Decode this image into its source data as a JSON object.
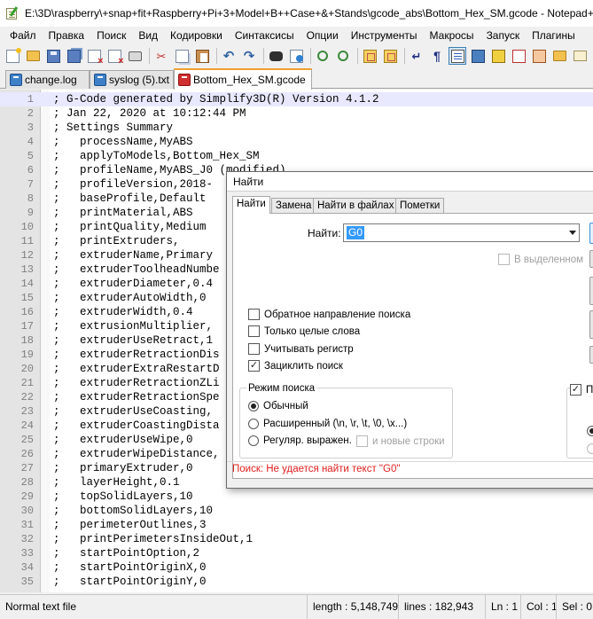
{
  "window": {
    "title": "E:\\3D\\raspberry\\+snap+fit+Raspberry+Pi+3+Model+B++Case+&+Stands\\gcode_abs\\Bottom_Hex_SM.gcode - Notepad++"
  },
  "menu": [
    "Файл",
    "Правка",
    "Поиск",
    "Вид",
    "Кодировки",
    "Синтаксисы",
    "Опции",
    "Инструменты",
    "Макросы",
    "Запуск",
    "Плагины"
  ],
  "toolbar": {
    "icons": [
      "new-file-icon",
      "open-folder-icon",
      "save-icon",
      "save-all-icon",
      "close-icon",
      "close-all-icon",
      "print-icon",
      "cut-icon",
      "copy-icon",
      "paste-icon",
      "undo-icon",
      "redo-icon",
      "find-icon",
      "replace-icon",
      "zoom-in-icon",
      "zoom-out-icon",
      "sync-scroll-v-icon",
      "sync-scroll-h-icon",
      "word-wrap-icon",
      "show-all-chars-icon",
      "indent-guide-icon",
      "user-language-icon",
      "fold-icon",
      "document-map-icon",
      "function-list-icon",
      "folder-workspace-icon",
      "monitoring-icon",
      "record-macro-icon"
    ]
  },
  "tabs": [
    {
      "label": "change.log",
      "active": false,
      "icon_color": "#3d80c8"
    },
    {
      "label": "syslog (5).txt",
      "active": false,
      "icon_color": "#3d80c8"
    },
    {
      "label": "Bottom_Hex_SM.gcode",
      "active": true,
      "icon_color": "#d03030"
    }
  ],
  "editor": {
    "lines": [
      {
        "n": "1",
        "text": "; G-Code generated by Simplify3D(R) Version 4.1.2"
      },
      {
        "n": "2",
        "text": "; Jan 22, 2020 at 10:12:44 PM"
      },
      {
        "n": "3",
        "text": "; Settings Summary"
      },
      {
        "n": "4",
        "text": ";   processName,MyABS"
      },
      {
        "n": "5",
        "text": ";   applyToModels,Bottom_Hex_SM"
      },
      {
        "n": "6",
        "text": ";   profileName,MyABS_J0 (modified)"
      },
      {
        "n": "7",
        "text": ";   profileVersion,2018-"
      },
      {
        "n": "8",
        "text": ";   baseProfile,Default"
      },
      {
        "n": "9",
        "text": ";   printMaterial,ABS"
      },
      {
        "n": "10",
        "text": ";   printQuality,Medium"
      },
      {
        "n": "11",
        "text": ";   printExtruders,"
      },
      {
        "n": "12",
        "text": ";   extruderName,Primary"
      },
      {
        "n": "13",
        "text": ";   extruderToolheadNumbe"
      },
      {
        "n": "14",
        "text": ";   extruderDiameter,0.4"
      },
      {
        "n": "15",
        "text": ";   extruderAutoWidth,0"
      },
      {
        "n": "16",
        "text": ";   extruderWidth,0.4"
      },
      {
        "n": "17",
        "text": ";   extrusionMultiplier,"
      },
      {
        "n": "18",
        "text": ";   extruderUseRetract,1"
      },
      {
        "n": "19",
        "text": ";   extruderRetractionDis"
      },
      {
        "n": "20",
        "text": ";   extruderExtraRestartD"
      },
      {
        "n": "21",
        "text": ";   extruderRetractionZLi"
      },
      {
        "n": "22",
        "text": ";   extruderRetractionSpe"
      },
      {
        "n": "23",
        "text": ";   extruderUseCoasting,"
      },
      {
        "n": "24",
        "text": ";   extruderCoastingDista"
      },
      {
        "n": "25",
        "text": ";   extruderUseWipe,0"
      },
      {
        "n": "26",
        "text": ";   extruderWipeDistance,"
      },
      {
        "n": "27",
        "text": ";   primaryExtruder,0"
      },
      {
        "n": "28",
        "text": ";   layerHeight,0.1"
      },
      {
        "n": "29",
        "text": ";   topSolidLayers,10"
      },
      {
        "n": "30",
        "text": ";   bottomSolidLayers,10"
      },
      {
        "n": "31",
        "text": ";   perimeterOutlines,3"
      },
      {
        "n": "32",
        "text": ";   printPerimetersInsideOut,1"
      },
      {
        "n": "33",
        "text": ";   startPointOption,2"
      },
      {
        "n": "34",
        "text": ";   startPointOriginX,0"
      },
      {
        "n": "35",
        "text": ";   startPointOriginY,0"
      }
    ]
  },
  "status": {
    "filetype": "Normal text file",
    "length": "length : 5,148,749",
    "lines": "lines : 182,943",
    "ln": "Ln : 1",
    "col": "Col : 1",
    "sel": "Sel : 0"
  },
  "find_dialog": {
    "title": "Найти",
    "tabs": [
      "Найти",
      "Замена",
      "Найти в файлах",
      "Пометки"
    ],
    "find_label": "Найти:",
    "find_value": "G0",
    "in_selection": "В выделенном",
    "options": [
      {
        "label": "Обратное направление поиска",
        "checked": false
      },
      {
        "label": "Только целые слова",
        "checked": false
      },
      {
        "label": "Учитывать регистр",
        "checked": false
      },
      {
        "label": "Зациклить поиск",
        "checked": true
      }
    ],
    "search_mode": {
      "legend": "Режим поиска",
      "normal": "Обычный",
      "extended": "Расширенный (\\n, \\r, \\t, \\0, \\x...)",
      "regex": "Регуляр. выражен.",
      "newline": "и новые строки",
      "selected": "normal"
    },
    "transparency_label": "Пр",
    "status_message": "Поиск: Не удается найти текст \"G0\"",
    "status_color": "#e02020"
  }
}
